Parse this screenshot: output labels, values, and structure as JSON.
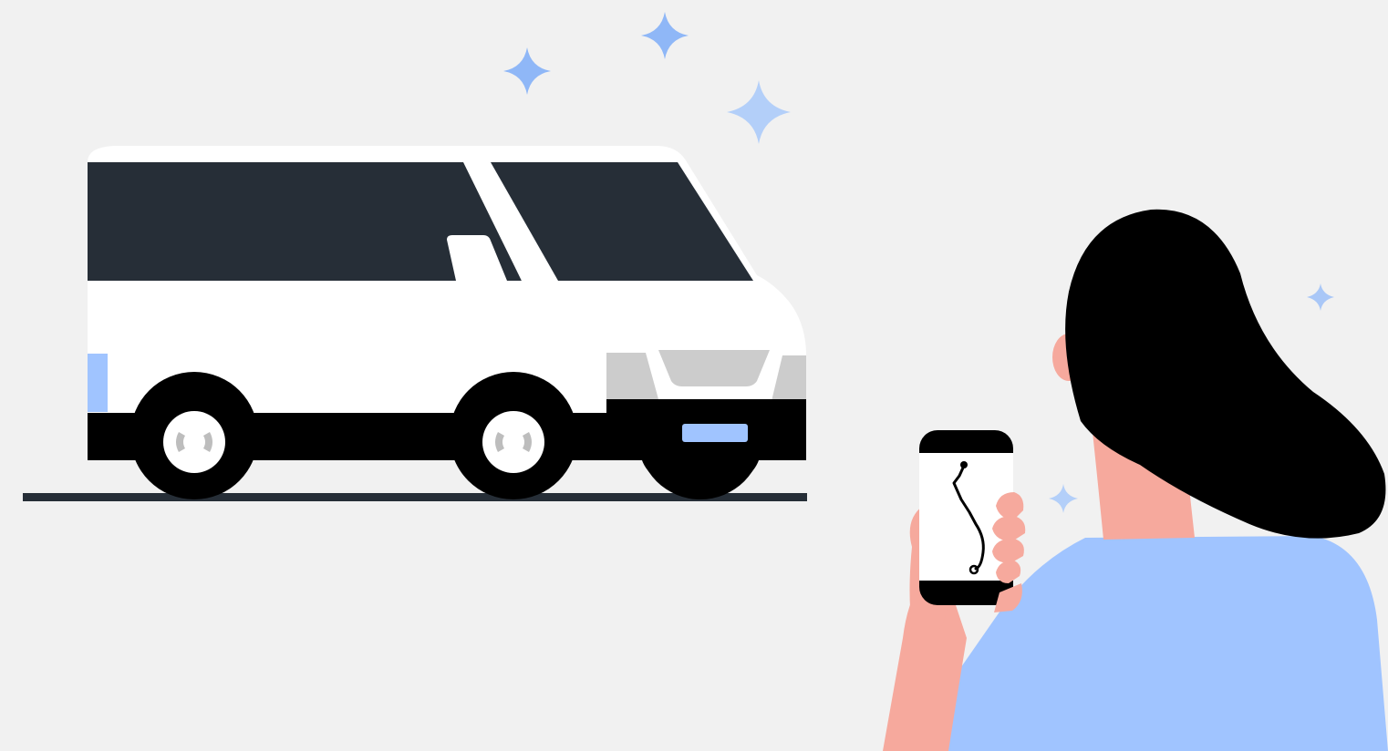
{
  "colors": {
    "background": "#f1f1f1",
    "van_body": "#ffffff",
    "van_windows": "#262e37",
    "van_black": "#000000",
    "van_grille": "#cccccc",
    "accent_blue": "#a0c4ff",
    "sparkle": "#8fb7f7",
    "sparkle_light": "#b3cff9",
    "ground": "#262e37",
    "skin": "#f6a99d",
    "hair": "#000000",
    "shirt": "#a0c4ff",
    "phone": "#000000",
    "phone_screen": "#ffffff"
  },
  "icons": {
    "sparkles": "sparkle-icon",
    "route": "route-icon"
  }
}
